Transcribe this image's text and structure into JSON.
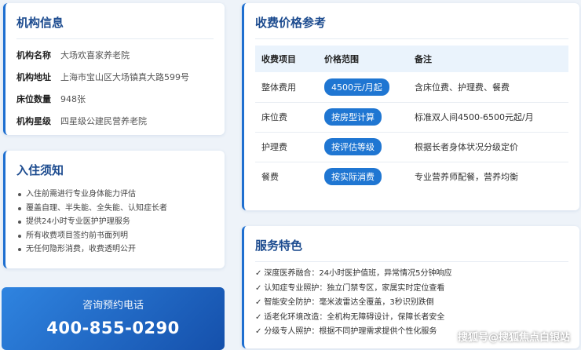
{
  "info": {
    "title": "机构信息",
    "rows": [
      {
        "label": "机构名称",
        "value": "大场欢喜家养老院"
      },
      {
        "label": "机构地址",
        "value": "上海市宝山区大场镇真大路599号"
      },
      {
        "label": "床位数量",
        "value": "948张"
      },
      {
        "label": "机构星级",
        "value": "四星级公建民营养老院"
      }
    ]
  },
  "notes": {
    "title": "入住须知",
    "items": [
      "入住前需进行专业身体能力评估",
      "覆盖自理、半失能、全失能、认知症长者",
      "提供24小时专业医护护理服务",
      "所有收费项目签约前书面列明",
      "无任何隐形消费，收费透明公开"
    ]
  },
  "consult": {
    "label": "咨询预约电话",
    "phone": "400-855-0290"
  },
  "fees": {
    "title": "收费价格参考",
    "headers": [
      "收费项目",
      "价格范围",
      "备注"
    ],
    "rows": [
      {
        "item": "整体费用",
        "price": "4500元/月起",
        "note": "含床位费、护理费、餐费"
      },
      {
        "item": "床位费",
        "price": "按房型计算",
        "note": "标准双人间4500-6500元起/月"
      },
      {
        "item": "护理费",
        "price": "按评估等级",
        "note": "根据长者身体状况分级定价"
      },
      {
        "item": "餐费",
        "price": "按实际消费",
        "note": "专业营养师配餐，营养均衡"
      }
    ]
  },
  "services": {
    "title": "服务特色",
    "check": "✓",
    "items": [
      "深度医养融合：24小时医护值班，异常情况5分钟响应",
      "认知症专业照护：独立门禁专区，家属实时定位查看",
      "智能安全防护：毫米波雷达全覆盖，3秒识别跌倒",
      "适老化环境改造：全机构无障碍设计，保障长者安全",
      "分级专人照护：根据不同护理需求提供个性化服务"
    ]
  },
  "watermark": "搜狐号@搜狐焦点白银站",
  "colors": {
    "accent": "#1e6fd0",
    "title": "#1c4b8f",
    "badge": "#1f76d2",
    "table_header_bg": "#eaf3fc",
    "page_bg": "#eef3f9"
  }
}
